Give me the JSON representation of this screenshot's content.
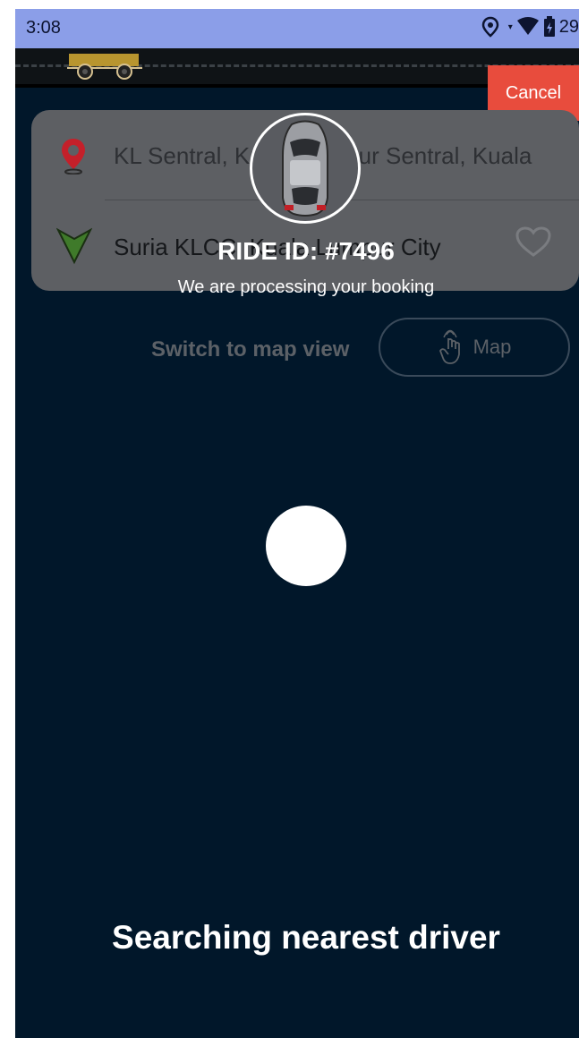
{
  "status_bar": {
    "time": "3:08",
    "battery": "29"
  },
  "cancel_label": "Cancel",
  "booking": {
    "pickup": "KL Sentral, Kuala Lumpur Sentral, Kuala",
    "dropoff": "Suria KLCC, Kuala Lumpur City"
  },
  "ride": {
    "id_label": "RIDE ID: #7496",
    "processing_text": "We are processing your booking"
  },
  "map_toggle": {
    "switch_label": "Switch to map view",
    "map_label": "Map"
  },
  "searching_text": "Searching nearest driver",
  "colors": {
    "background": "#01172a",
    "status_bar": "#8b9ee8",
    "cancel": "#e84c3d",
    "card": "#5d5f63"
  },
  "icons": [
    "location-icon",
    "wifi-icon",
    "battery-icon",
    "pin-icon",
    "arrow-icon",
    "heart-icon",
    "hand-tap-icon",
    "car-icon",
    "truck-icon"
  ]
}
